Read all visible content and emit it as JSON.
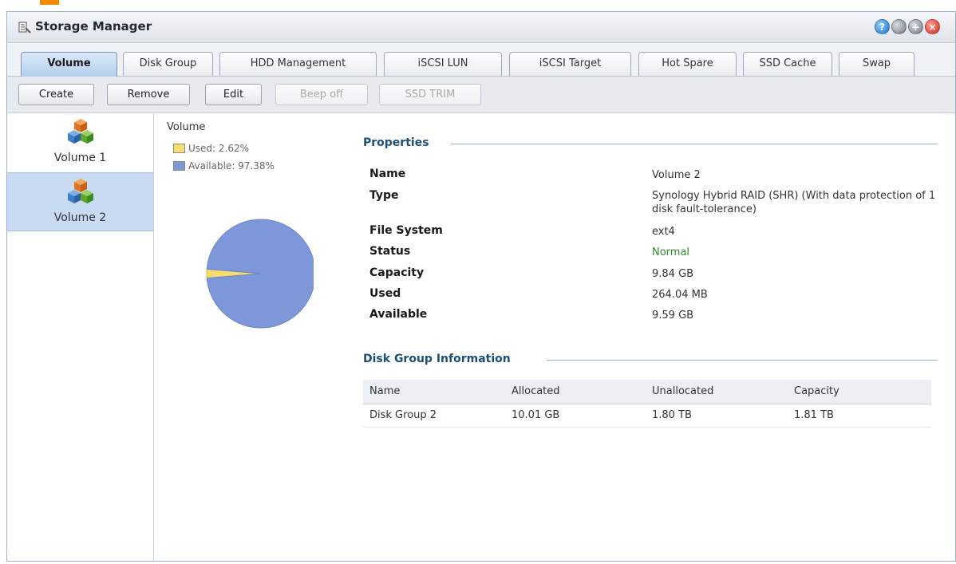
{
  "window": {
    "title": "Storage Manager",
    "controls": {
      "help": "?",
      "maximize": "+",
      "close": "×"
    }
  },
  "tabs": [
    {
      "label": "Volume",
      "active": true
    },
    {
      "label": "Disk Group",
      "active": false
    },
    {
      "label": "HDD Management",
      "active": false
    },
    {
      "label": "iSCSI LUN",
      "active": false
    },
    {
      "label": "iSCSI Target",
      "active": false
    },
    {
      "label": "Hot Spare",
      "active": false
    },
    {
      "label": "SSD Cache",
      "active": false
    },
    {
      "label": "Swap",
      "active": false
    }
  ],
  "toolbar": {
    "create": "Create",
    "remove": "Remove",
    "edit": "Edit",
    "beep_off": "Beep off",
    "ssd_trim": "SSD TRIM"
  },
  "sidebar": {
    "items": [
      {
        "label": "Volume 1",
        "icon": "volume-cubes-icon",
        "selected": false
      },
      {
        "label": "Volume 2",
        "icon": "volume-cubes-icon",
        "selected": true
      }
    ]
  },
  "chart": {
    "title": "Volume",
    "legend": [
      {
        "label": "Used: 2.62%",
        "color": "#f7dd6b"
      },
      {
        "label": "Available: 97.38%",
        "color": "#7d97d9"
      }
    ]
  },
  "chart_data": {
    "type": "pie",
    "title": "Volume",
    "slices": [
      {
        "label": "Used",
        "value": 2.62,
        "color": "#f7dd6b"
      },
      {
        "label": "Available",
        "value": 97.38,
        "color": "#7d97d9"
      }
    ],
    "legend_position": "top-left"
  },
  "properties": {
    "header": "Properties",
    "rows": [
      {
        "label": "Name",
        "value": "Volume 2"
      },
      {
        "label": "Type",
        "value": "Synology Hybrid RAID (SHR) (With data protection of 1 disk fault-tolerance)"
      },
      {
        "label": "File System",
        "value": "ext4"
      },
      {
        "label": "Status",
        "value": "Normal"
      },
      {
        "label": "Capacity",
        "value": "9.84 GB"
      },
      {
        "label": "Used",
        "value": "264.04 MB"
      },
      {
        "label": "Available",
        "value": "9.59 GB"
      }
    ]
  },
  "disk_group": {
    "header": "Disk Group Information",
    "columns": [
      "Name",
      "Allocated",
      "Unallocated",
      "Capacity"
    ],
    "rows": [
      [
        "Disk Group 2",
        "10.01 GB",
        "1.80 TB",
        "1.81 TB"
      ]
    ]
  },
  "colors": {
    "accent": "#1c4f7a",
    "status_normal": "#2e8b2e",
    "selected_bg": "#c9dbf2"
  }
}
